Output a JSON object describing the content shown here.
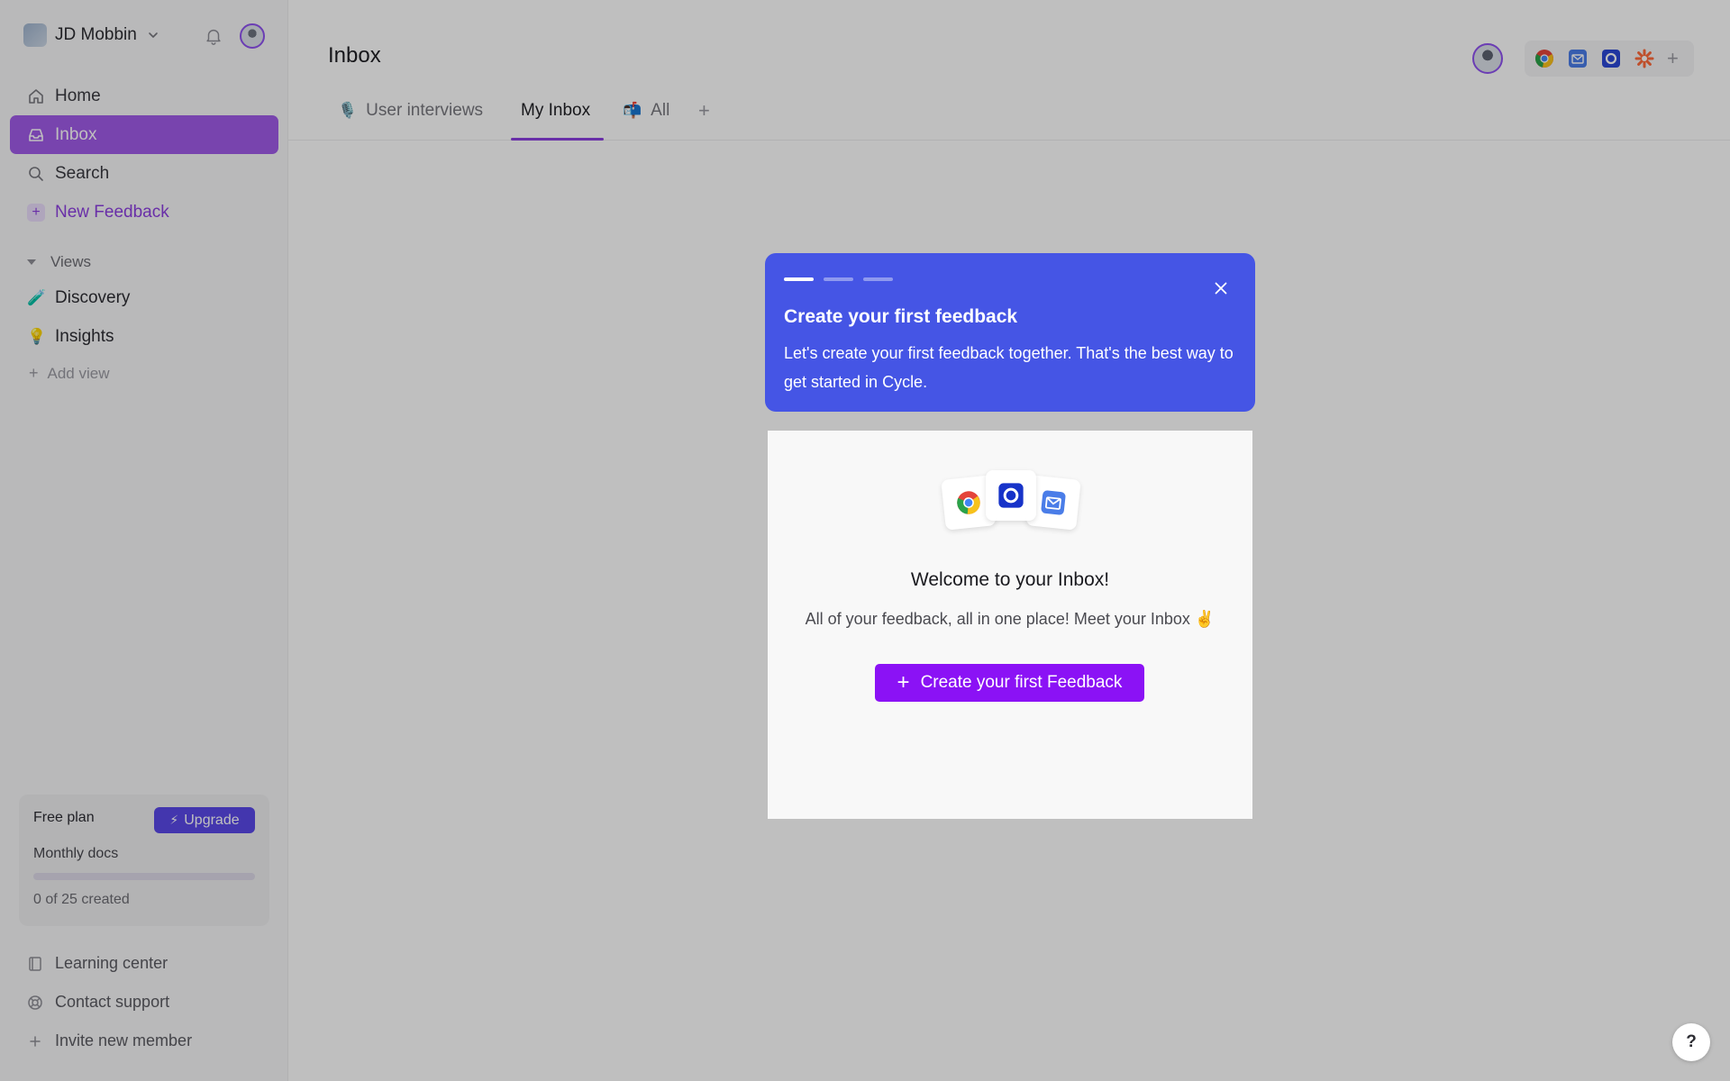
{
  "sidebar": {
    "workspace_name": "JD Mobbin",
    "nav": [
      {
        "label": "Home",
        "icon": "home-icon"
      },
      {
        "label": "Inbox",
        "icon": "inbox-icon"
      },
      {
        "label": "Search",
        "icon": "search-icon"
      },
      {
        "label": "New Feedback",
        "icon": "plus-icon"
      }
    ],
    "views_label": "Views",
    "views": [
      {
        "label": "Discovery",
        "emoji": "🧪"
      },
      {
        "label": "Insights",
        "emoji": "💡"
      }
    ],
    "add_view_label": "Add view",
    "plan": {
      "title": "Free plan",
      "upgrade_label": "Upgrade",
      "subtitle": "Monthly docs",
      "count_text": "0 of 25 created",
      "progress": 0
    },
    "footer": [
      {
        "label": "Learning center",
        "icon": "book-icon"
      },
      {
        "label": "Contact support",
        "icon": "lifebuoy-icon"
      },
      {
        "label": "Invite new member",
        "icon": "plus-icon"
      }
    ]
  },
  "header": {
    "title": "Inbox",
    "integrations": [
      "chrome-icon",
      "email-icon",
      "intercom-icon",
      "zapier-icon"
    ]
  },
  "tabs": [
    {
      "label": "User interviews",
      "emoji": "🎙️"
    },
    {
      "label": "My Inbox",
      "emoji": ""
    },
    {
      "label": "All",
      "emoji": "📬"
    }
  ],
  "tour": {
    "step": 1,
    "total_steps": 3,
    "title": "Create your first feedback",
    "body": "Let's create your first feedback together. That's the best way to get started in Cycle."
  },
  "empty_state": {
    "title": "Welcome to your Inbox!",
    "subtitle": "All of your feedback, all in one place! Meet your Inbox ✌️",
    "cta_label": "Create your first Feedback"
  },
  "help_label": "?",
  "colors": {
    "accent": "#8d3fe0",
    "active_nav": "#a05be9",
    "tour_blue": "#4555e5",
    "cta": "#8b12f5"
  }
}
